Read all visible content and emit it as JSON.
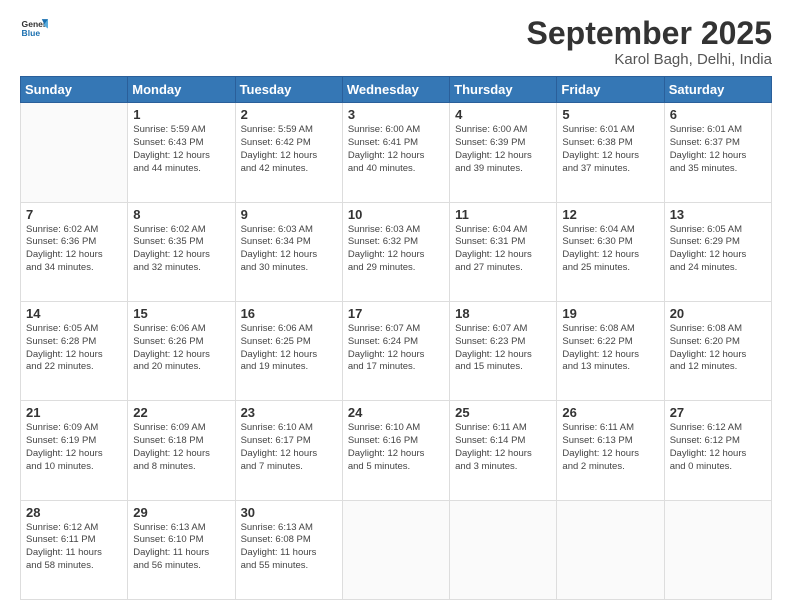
{
  "logo": {
    "general": "General",
    "blue": "Blue"
  },
  "header": {
    "month": "September 2025",
    "location": "Karol Bagh, Delhi, India"
  },
  "weekdays": [
    "Sunday",
    "Monday",
    "Tuesday",
    "Wednesday",
    "Thursday",
    "Friday",
    "Saturday"
  ],
  "weeks": [
    [
      {
        "day": "",
        "detail": ""
      },
      {
        "day": "1",
        "detail": "Sunrise: 5:59 AM\nSunset: 6:43 PM\nDaylight: 12 hours\nand 44 minutes."
      },
      {
        "day": "2",
        "detail": "Sunrise: 5:59 AM\nSunset: 6:42 PM\nDaylight: 12 hours\nand 42 minutes."
      },
      {
        "day": "3",
        "detail": "Sunrise: 6:00 AM\nSunset: 6:41 PM\nDaylight: 12 hours\nand 40 minutes."
      },
      {
        "day": "4",
        "detail": "Sunrise: 6:00 AM\nSunset: 6:39 PM\nDaylight: 12 hours\nand 39 minutes."
      },
      {
        "day": "5",
        "detail": "Sunrise: 6:01 AM\nSunset: 6:38 PM\nDaylight: 12 hours\nand 37 minutes."
      },
      {
        "day": "6",
        "detail": "Sunrise: 6:01 AM\nSunset: 6:37 PM\nDaylight: 12 hours\nand 35 minutes."
      }
    ],
    [
      {
        "day": "7",
        "detail": "Sunrise: 6:02 AM\nSunset: 6:36 PM\nDaylight: 12 hours\nand 34 minutes."
      },
      {
        "day": "8",
        "detail": "Sunrise: 6:02 AM\nSunset: 6:35 PM\nDaylight: 12 hours\nand 32 minutes."
      },
      {
        "day": "9",
        "detail": "Sunrise: 6:03 AM\nSunset: 6:34 PM\nDaylight: 12 hours\nand 30 minutes."
      },
      {
        "day": "10",
        "detail": "Sunrise: 6:03 AM\nSunset: 6:32 PM\nDaylight: 12 hours\nand 29 minutes."
      },
      {
        "day": "11",
        "detail": "Sunrise: 6:04 AM\nSunset: 6:31 PM\nDaylight: 12 hours\nand 27 minutes."
      },
      {
        "day": "12",
        "detail": "Sunrise: 6:04 AM\nSunset: 6:30 PM\nDaylight: 12 hours\nand 25 minutes."
      },
      {
        "day": "13",
        "detail": "Sunrise: 6:05 AM\nSunset: 6:29 PM\nDaylight: 12 hours\nand 24 minutes."
      }
    ],
    [
      {
        "day": "14",
        "detail": "Sunrise: 6:05 AM\nSunset: 6:28 PM\nDaylight: 12 hours\nand 22 minutes."
      },
      {
        "day": "15",
        "detail": "Sunrise: 6:06 AM\nSunset: 6:26 PM\nDaylight: 12 hours\nand 20 minutes."
      },
      {
        "day": "16",
        "detail": "Sunrise: 6:06 AM\nSunset: 6:25 PM\nDaylight: 12 hours\nand 19 minutes."
      },
      {
        "day": "17",
        "detail": "Sunrise: 6:07 AM\nSunset: 6:24 PM\nDaylight: 12 hours\nand 17 minutes."
      },
      {
        "day": "18",
        "detail": "Sunrise: 6:07 AM\nSunset: 6:23 PM\nDaylight: 12 hours\nand 15 minutes."
      },
      {
        "day": "19",
        "detail": "Sunrise: 6:08 AM\nSunset: 6:22 PM\nDaylight: 12 hours\nand 13 minutes."
      },
      {
        "day": "20",
        "detail": "Sunrise: 6:08 AM\nSunset: 6:20 PM\nDaylight: 12 hours\nand 12 minutes."
      }
    ],
    [
      {
        "day": "21",
        "detail": "Sunrise: 6:09 AM\nSunset: 6:19 PM\nDaylight: 12 hours\nand 10 minutes."
      },
      {
        "day": "22",
        "detail": "Sunrise: 6:09 AM\nSunset: 6:18 PM\nDaylight: 12 hours\nand 8 minutes."
      },
      {
        "day": "23",
        "detail": "Sunrise: 6:10 AM\nSunset: 6:17 PM\nDaylight: 12 hours\nand 7 minutes."
      },
      {
        "day": "24",
        "detail": "Sunrise: 6:10 AM\nSunset: 6:16 PM\nDaylight: 12 hours\nand 5 minutes."
      },
      {
        "day": "25",
        "detail": "Sunrise: 6:11 AM\nSunset: 6:14 PM\nDaylight: 12 hours\nand 3 minutes."
      },
      {
        "day": "26",
        "detail": "Sunrise: 6:11 AM\nSunset: 6:13 PM\nDaylight: 12 hours\nand 2 minutes."
      },
      {
        "day": "27",
        "detail": "Sunrise: 6:12 AM\nSunset: 6:12 PM\nDaylight: 12 hours\nand 0 minutes."
      }
    ],
    [
      {
        "day": "28",
        "detail": "Sunrise: 6:12 AM\nSunset: 6:11 PM\nDaylight: 11 hours\nand 58 minutes."
      },
      {
        "day": "29",
        "detail": "Sunrise: 6:13 AM\nSunset: 6:10 PM\nDaylight: 11 hours\nand 56 minutes."
      },
      {
        "day": "30",
        "detail": "Sunrise: 6:13 AM\nSunset: 6:08 PM\nDaylight: 11 hours\nand 55 minutes."
      },
      {
        "day": "",
        "detail": ""
      },
      {
        "day": "",
        "detail": ""
      },
      {
        "day": "",
        "detail": ""
      },
      {
        "day": "",
        "detail": ""
      }
    ]
  ]
}
